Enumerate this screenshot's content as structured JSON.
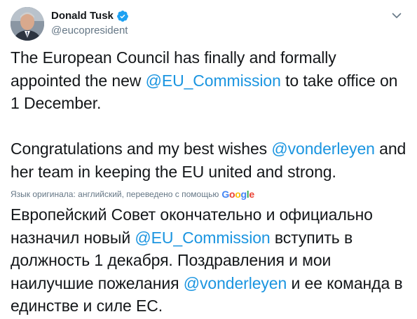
{
  "author": {
    "display_name": "Donald Tusk",
    "handle": "@eucopresident",
    "verified": true,
    "avatar_icon": "profile-photo"
  },
  "tweet": {
    "paragraph1_before": "The European Council has finally and formally appointed the new ",
    "paragraph1_mention": "@EU_Commission",
    "paragraph1_after": " to take office on 1 December.",
    "paragraph2_before": "Congratulations and my best wishes ",
    "paragraph2_mention": "@vonderleyen",
    "paragraph2_after": " and her team in keeping the EU united and strong."
  },
  "translation": {
    "label": "Язык оригинала: английский, переведено с помощью",
    "provider": "Google",
    "provider_colors": [
      "#4285f4",
      "#ea4335",
      "#fbbc05",
      "#4285f4",
      "#34a853",
      "#ea4335"
    ],
    "text_part1": "Европейский Совет окончательно и официально назначил новый ",
    "mention1": "@EU_Commission",
    "text_part2": " вступить в должность 1 декабря. Поздравления и мои наилучшие пожелания ",
    "mention2": "@vonderleyen",
    "text_part3": " и ее команда в единстве и силе ЕС."
  },
  "colors": {
    "link": "#1b95e0",
    "verified_badge": "#1da1f2",
    "secondary_text": "#657786",
    "primary_text": "#14171a"
  },
  "icons": {
    "verified": "verified-badge-icon",
    "more": "chevron-down-icon"
  }
}
